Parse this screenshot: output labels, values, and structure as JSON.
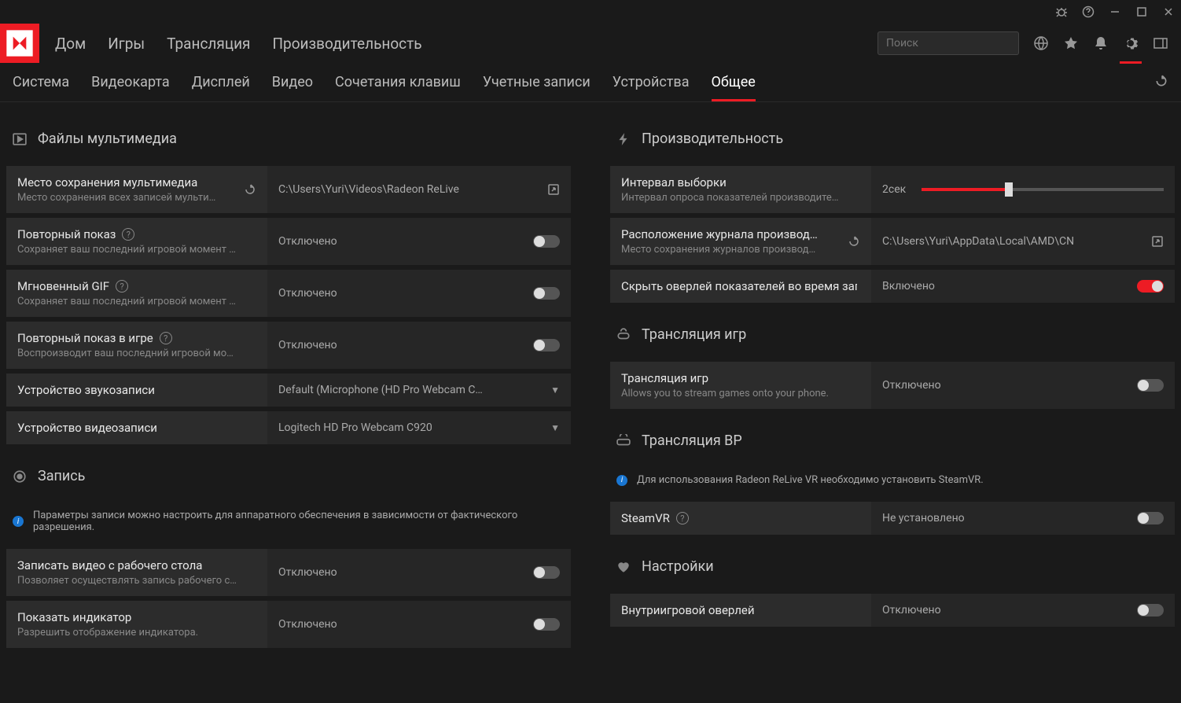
{
  "nav": {
    "home": "Дом",
    "games": "Игры",
    "streaming": "Трансляция",
    "performance": "Производительность"
  },
  "search": {
    "placeholder": "Поиск"
  },
  "tabs": {
    "system": "Система",
    "graphics": "Видеокарта",
    "display": "Дисплей",
    "video": "Видео",
    "hotkeys": "Сочетания клавиш",
    "accounts": "Учетные записи",
    "devices": "Устройства",
    "general": "Общее"
  },
  "sections": {
    "media_files": "Файлы мультимедиа",
    "recording": "Запись",
    "performance": "Производительность",
    "game_streaming": "Трансляция игр",
    "vr_streaming": "Трансляция ВР",
    "preferences": "Настройки"
  },
  "left": {
    "media_location": {
      "label": "Место сохранения мультимедиа",
      "desc": "Место сохранения всех записей мульти…",
      "value": "C:\\Users\\Yuri\\Videos\\Radeon ReLive"
    },
    "instant_replay": {
      "label": "Повторный показ",
      "desc": "Сохраняет ваш последний игровой момент в ви…",
      "value": "Отключено"
    },
    "instant_gif": {
      "label": "Мгновенный GIF",
      "desc": "Сохраняет ваш последний игровой момент в фа…",
      "value": "Отключено"
    },
    "ingame_replay": {
      "label": "Повторный показ в игре",
      "desc": "Воспроизводит ваш последний игровой момент.",
      "value": "Отключено"
    },
    "audio_device": {
      "label": "Устройство звукозаписи",
      "value": "Default (Microphone (HD Pro Webcam C…"
    },
    "video_device": {
      "label": "Устройство видеозаписи",
      "value": "Logitech HD Pro Webcam C920"
    },
    "recording_info": "Параметры записи можно настроить для аппаратного обеспечения в зависимости от фактического разрешения.",
    "record_desktop": {
      "label": "Записать видео с рабочего стола",
      "desc": "Позволяет осуществлять запись рабочего стола.",
      "value": "Отключено"
    },
    "show_indicator": {
      "label": "Показать индикатор",
      "desc": "Разрешить отображение индикатора.",
      "value": "Отключено"
    }
  },
  "right": {
    "sampling_interval": {
      "label": "Интервал выборки",
      "desc": "Интервал опроса показателей производительно…",
      "value": "2сек"
    },
    "perf_log_location": {
      "label": "Расположение журнала производ…",
      "desc": "Место сохранения журналов производ…",
      "value": "C:\\Users\\Yuri\\AppData\\Local\\AMD\\CN"
    },
    "hide_overlay": {
      "label": "Скрыть оверлей показателей во время зап…",
      "value": "Включено"
    },
    "game_stream": {
      "label": "Трансляция игр",
      "desc": "Allows you to stream games onto your phone.",
      "value": "Отключено"
    },
    "vr_info": "Для использования Radeon ReLive VR необходимо установить SteamVR.",
    "steamvr": {
      "label": "SteamVR",
      "value": "Не установлено"
    },
    "ingame_overlay": {
      "label": "Внутриигровой оверлей",
      "value": "Отключено"
    }
  }
}
